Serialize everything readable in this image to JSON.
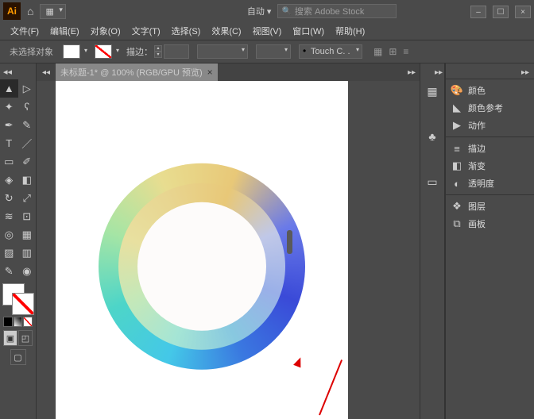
{
  "titlebar": {
    "auto_label": "自动",
    "search_placeholder": "搜索 Adobe Stock"
  },
  "menubar": {
    "items": [
      {
        "label": "文件(F)"
      },
      {
        "label": "编辑(E)"
      },
      {
        "label": "对象(O)"
      },
      {
        "label": "文字(T)"
      },
      {
        "label": "选择(S)"
      },
      {
        "label": "效果(C)"
      },
      {
        "label": "视图(V)"
      },
      {
        "label": "窗口(W)"
      },
      {
        "label": "帮助(H)"
      }
    ]
  },
  "controlbar": {
    "selection_status": "未选择对象",
    "stroke_label": "描边：",
    "brush_text": "Touch C. ."
  },
  "document": {
    "tab_title": "未标题-1* @ 100% (RGB/GPU 预览)"
  },
  "panels": {
    "color": "颜色",
    "color_guide": "颜色参考",
    "actions": "动作",
    "stroke": "描边",
    "gradient": "渐变",
    "transparency": "透明度",
    "layers": "图层",
    "artboards": "画板"
  }
}
